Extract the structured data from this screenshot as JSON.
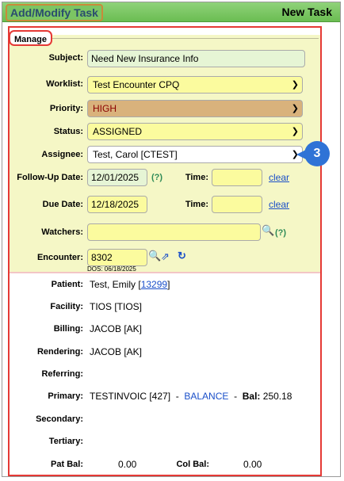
{
  "header": {
    "left_title": "Add/Modify Task",
    "right_title": "New Task"
  },
  "manage": {
    "legend": "Manage",
    "subject": {
      "label": "Subject:",
      "value": "Need New Insurance Info"
    },
    "worklist": {
      "label": "Worklist:",
      "value": "Test Encounter CPQ"
    },
    "priority": {
      "label": "Priority:",
      "value": "HIGH"
    },
    "status": {
      "label": "Status:",
      "value": "ASSIGNED"
    },
    "assignee": {
      "label": "Assignee:",
      "value": "Test, Carol [CTEST]"
    },
    "followup": {
      "label": "Follow-Up Date:",
      "value": "12/01/2025",
      "help": "(?)",
      "time_label": "Time:",
      "clear": "clear"
    },
    "due": {
      "label": "Due Date:",
      "value": "12/18/2025",
      "time_label": "Time:",
      "clear": "clear"
    },
    "watchers": {
      "label": "Watchers:",
      "help": "(?)"
    },
    "encounter": {
      "label": "Encounter:",
      "value": "8302",
      "dos": "DOS: 06/18/2025"
    },
    "callout": "3"
  },
  "details": {
    "patient": {
      "label": "Patient:",
      "name": "Test, Emily",
      "bracket_open": "[",
      "id": "13299",
      "bracket_close": "]"
    },
    "facility": {
      "label": "Facility:",
      "value": "TIOS [TIOS]"
    },
    "billing": {
      "label": "Billing:",
      "value": "JACOB [AK]"
    },
    "rendering": {
      "label": "Rendering:",
      "value": "JACOB [AK]"
    },
    "referring": {
      "label": "Referring:",
      "value": ""
    },
    "primary": {
      "label": "Primary:",
      "value": "TESTINVOIC [427]",
      "sep1": "-",
      "balance": "BALANCE",
      "sep2": "-",
      "bal_label": "Bal:",
      "bal_value": "250.18"
    },
    "secondary": {
      "label": "Secondary:",
      "value": ""
    },
    "tertiary": {
      "label": "Tertiary:",
      "value": ""
    },
    "pat_bal": {
      "label": "Pat Bal:",
      "value": "0.00"
    },
    "col_bal": {
      "label": "Col Bal:",
      "value": "0.00"
    }
  },
  "colors": {
    "yellow_field": "#fbfb9e",
    "priority_field": "#d9b27c",
    "readonly_field": "#e6f5d5",
    "panel": "#f5f7c6"
  },
  "icons": {
    "encounter_search": "magnifier-icon",
    "encounter_open": "external-link-icon",
    "encounter_refresh": "refresh-icon",
    "watchers_search": "magnifier-icon"
  }
}
